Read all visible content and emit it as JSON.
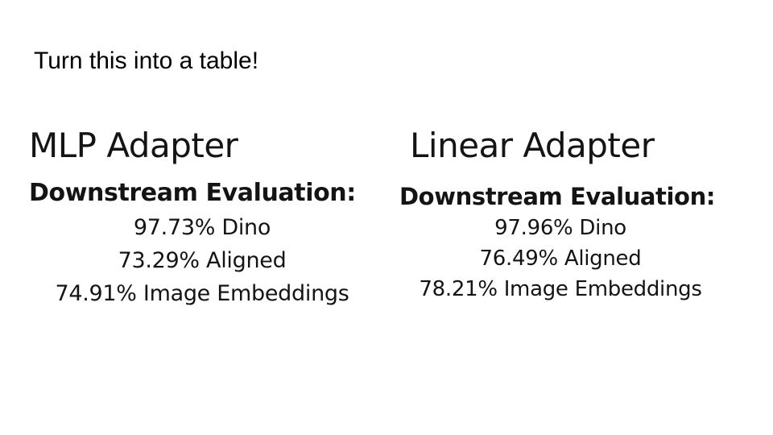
{
  "slide": {
    "title": "Turn this into a table!"
  },
  "panels": [
    {
      "title": "MLP Adapter",
      "heading": "Downstream Evaluation:",
      "metrics": [
        "97.73% Dino",
        "73.29% Aligned",
        "74.91% Image Embeddings"
      ]
    },
    {
      "title": "Linear Adapter",
      "heading": "Downstream Evaluation:",
      "metrics": [
        "97.96% Dino",
        "76.49% Aligned",
        "78.21% Image Embeddings"
      ]
    }
  ]
}
